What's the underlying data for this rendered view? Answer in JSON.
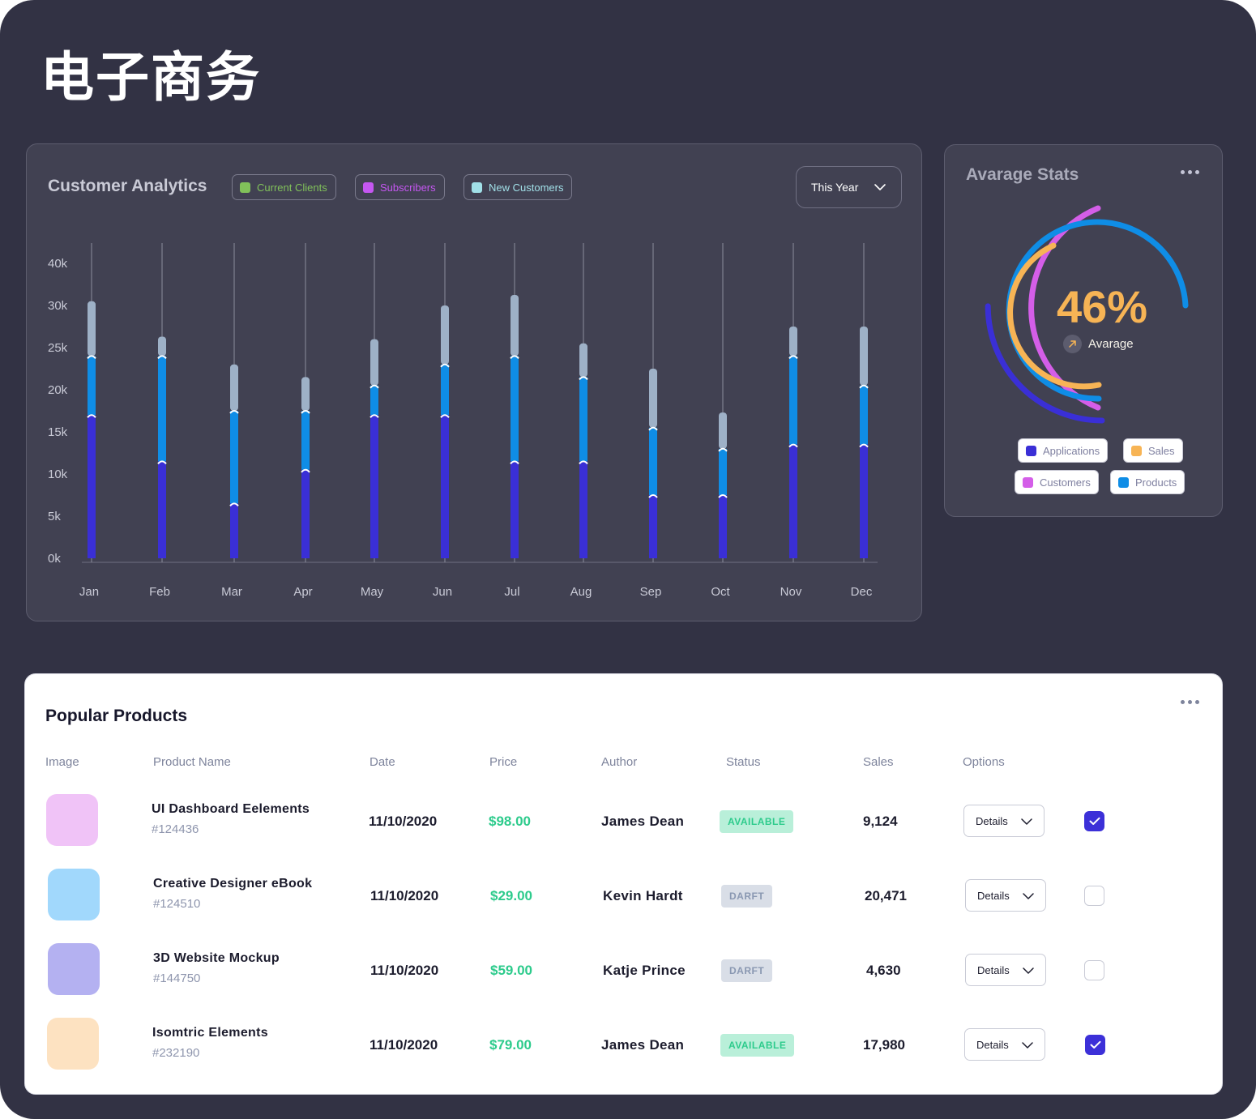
{
  "page_title": "电子商务",
  "analytics": {
    "title": "Customer Analytics",
    "legend": [
      {
        "label": "Current Clients",
        "color": "#81c15a"
      },
      {
        "label": "Subscribers",
        "color": "#c557f1"
      },
      {
        "label": "New Customers",
        "color": "#a1e0e8"
      }
    ],
    "period_select": "This Year"
  },
  "chart_data": {
    "type": "bar",
    "stacked": true,
    "categories": [
      "Jan",
      "Feb",
      "Mar",
      "Apr",
      "May",
      "Jun",
      "Jul",
      "Aug",
      "Sep",
      "Oct",
      "Nov",
      "Dec"
    ],
    "y_ticks": [
      "40k",
      "30k",
      "25k",
      "20k",
      "15k",
      "10k",
      "5k",
      "0k"
    ],
    "series": [
      {
        "color": "#3a2fd6",
        "values": [
          17000,
          11500,
          6500,
          10500,
          17000,
          17000,
          11500,
          11500,
          7500,
          7500,
          13500,
          13500
        ]
      },
      {
        "color": "#0f8de6",
        "values": [
          7000,
          12500,
          11000,
          7000,
          3500,
          6000,
          12500,
          10000,
          8000,
          5500,
          10500,
          7000
        ]
      },
      {
        "color": "#9eb1c7",
        "values": [
          7000,
          2300,
          5500,
          4000,
          5500,
          7000,
          8500,
          4000,
          7000,
          4300,
          3500,
          7000
        ]
      }
    ],
    "grid": false
  },
  "stats": {
    "title": "Avarage Stats",
    "value": "46%",
    "value_label": "Avarage",
    "legend": [
      {
        "label": "Applications",
        "color": "#3a2fd6"
      },
      {
        "label": "Sales",
        "color": "#f7b455"
      },
      {
        "label": "Customers",
        "color": "#d45ee8"
      },
      {
        "label": "Products",
        "color": "#0f8de6"
      }
    ]
  },
  "products": {
    "title": "Popular Products",
    "columns": [
      "Image",
      "Product Name",
      "Date",
      "Price",
      "Author",
      "Status",
      "Sales",
      "Options"
    ],
    "rows": [
      {
        "thumb_color": "#f0c3f7",
        "name": "UI Dashboard Eelements",
        "id": "#124436",
        "date": "11/10/2020",
        "price": "$98.00",
        "author": "James Dean",
        "status": "AVAILABLE",
        "sales": "9,124",
        "option": "Details",
        "checked": true
      },
      {
        "thumb_color": "#a1d8fc",
        "name": "Creative Designer eBook",
        "id": "#124510",
        "date": "11/10/2020",
        "price": "$29.00",
        "author": "Kevin Hardt",
        "status": "DARFT",
        "sales": "20,471",
        "option": "Details",
        "checked": false
      },
      {
        "thumb_color": "#b4b1f1",
        "name": "3D Website Mockup",
        "id": "#144750",
        "date": "11/10/2020",
        "price": "$59.00",
        "author": "Katje Prince",
        "status": "DARFT",
        "sales": "4,630",
        "option": "Details",
        "checked": false
      },
      {
        "thumb_color": "#fde2c1",
        "name": "Isomtric Elements",
        "id": "#232190",
        "date": "11/10/2020",
        "price": "$79.00",
        "author": "James Dean",
        "status": "AVAILABLE",
        "sales": "17,980",
        "option": "Details",
        "checked": true
      }
    ]
  }
}
